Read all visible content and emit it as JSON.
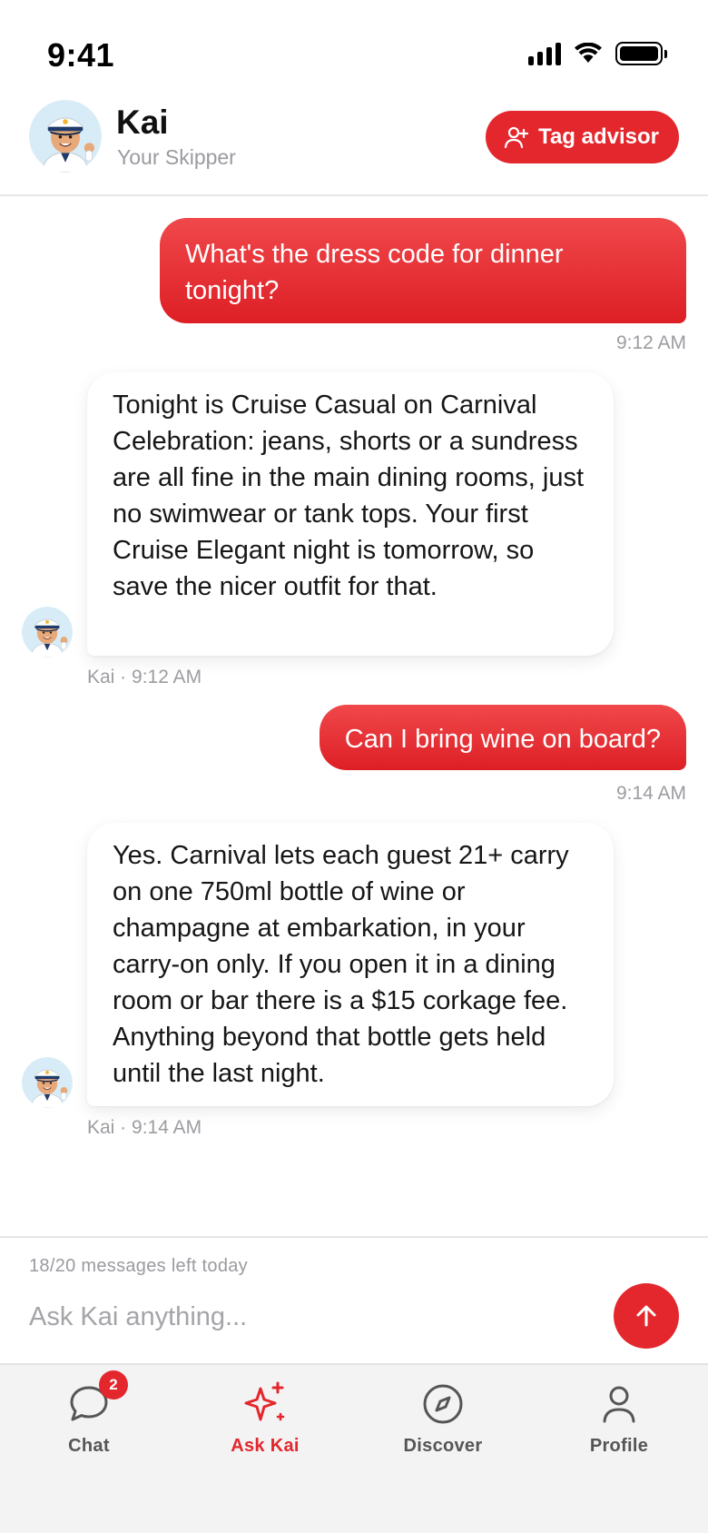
{
  "status_bar": {
    "time": "9:41"
  },
  "header": {
    "name": "Kai",
    "subtitle": "Your Skipper",
    "tag_button_label": "Tag advisor"
  },
  "messages": [
    {
      "from": "user",
      "text": "What's the dress code for dinner tonight?",
      "time": "9:12 AM"
    },
    {
      "from": "kai",
      "text": "Tonight is Cruise Casual on Carnival Celebration: jeans, shorts or a sundress are all fine in the main dining rooms, just no swimwear or tank tops. Your first Cruise Elegant night is tomorrow, so save the nicer outfit for that.",
      "meta": "Kai · 9:12 AM"
    },
    {
      "from": "user",
      "text": "Can I bring wine on board?",
      "time": "9:14 AM"
    },
    {
      "from": "kai",
      "text": "Yes. Carnival lets each guest 21+ carry on one 750ml bottle of wine or champagne at embarkation, in your carry-on only. If you open it in a dining room or bar there is a $15 corkage fee. Anything beyond that bottle gets held until the last night.",
      "meta": "Kai · 9:14 AM"
    }
  ],
  "composer": {
    "quota_text": "18/20 messages left today",
    "placeholder": "Ask Kai anything..."
  },
  "tabs": [
    {
      "label": "Chat",
      "icon": "chat-bubble-icon",
      "badge": "2"
    },
    {
      "label": "Ask Kai",
      "icon": "sparkle-icon",
      "active": true
    },
    {
      "label": "Discover",
      "icon": "compass-icon"
    },
    {
      "label": "Profile",
      "icon": "person-icon"
    }
  ],
  "colors": {
    "accent": "#e3272d",
    "muted_text": "#9a9aa0",
    "tab_bar_bg": "#f3f3f4"
  }
}
